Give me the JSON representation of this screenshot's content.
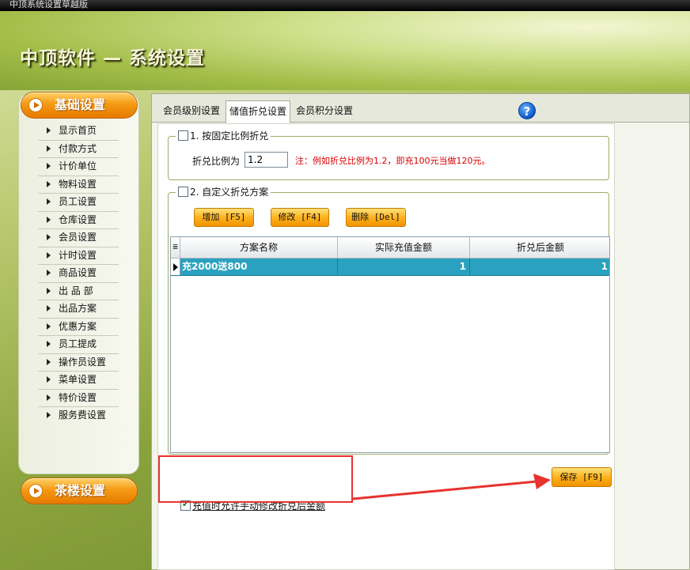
{
  "window": {
    "title": "中顶系统设置草越版"
  },
  "header": {
    "app_title": "中顶软件 — 系统设置"
  },
  "sidebar": {
    "groups": [
      {
        "label": "基础设置"
      },
      {
        "label": "茶楼设置"
      }
    ],
    "items": [
      {
        "label": "显示首页"
      },
      {
        "label": "付款方式"
      },
      {
        "label": "计价单位"
      },
      {
        "label": "物料设置"
      },
      {
        "label": "员工设置"
      },
      {
        "label": "仓库设置"
      },
      {
        "label": "会员设置"
      },
      {
        "label": "计时设置"
      },
      {
        "label": "商品设置"
      },
      {
        "label": "出 品 部"
      },
      {
        "label": "出品方案"
      },
      {
        "label": "优惠方案"
      },
      {
        "label": "员工提成"
      },
      {
        "label": "操作员设置"
      },
      {
        "label": "菜单设置"
      },
      {
        "label": "特价设置"
      },
      {
        "label": "服务费设置"
      }
    ]
  },
  "tabs": [
    {
      "label": "会员级别设置",
      "active": false
    },
    {
      "label": "储值折兑设置",
      "active": true
    },
    {
      "label": "会员积分设置",
      "active": false
    }
  ],
  "help": {
    "icon": "question-icon",
    "label": "?"
  },
  "fixed_ratio": {
    "legend": "1. 按固定比例折兑",
    "checked": false,
    "label": "折兑比例为",
    "value": "1.2",
    "note": "注：例如折兑比例为1.2，即充100元当做120元。"
  },
  "custom_plan": {
    "legend": "2. 自定义折兑方案",
    "checked": false,
    "buttons": {
      "add": "增加 [F5]",
      "edit": "修改 [F4]",
      "delete": "删除 [Del]"
    },
    "grid": {
      "corner": "≣",
      "columns": [
        "方案名称",
        "实际充值金额",
        "折兑后金额"
      ],
      "rows": [
        {
          "name": "充2000送800",
          "actual": "1",
          "after": "1"
        }
      ]
    }
  },
  "allow_manual_edit": {
    "label": "充值时允许手动修改折兑后金额",
    "checked": true
  },
  "save_button": {
    "label": "保存 [F9]"
  },
  "annotation": {
    "box_color": "#e8322e",
    "arrow_color": "#e8322e"
  }
}
